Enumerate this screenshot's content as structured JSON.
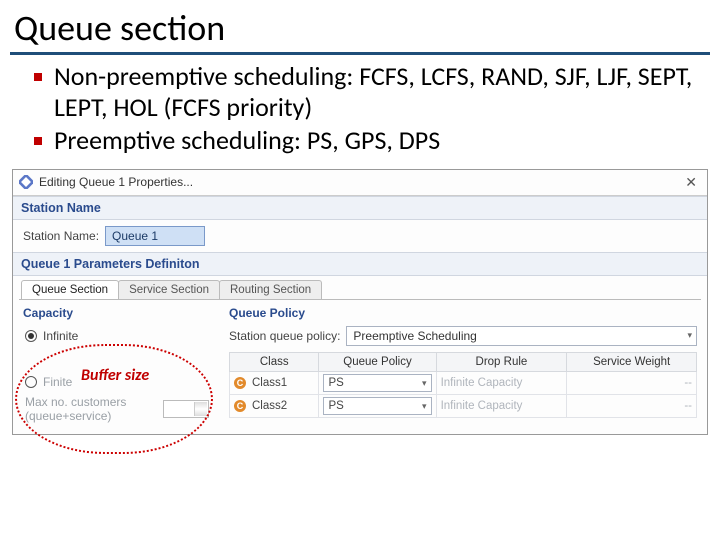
{
  "slide": {
    "title": "Queue section",
    "bullets": [
      "Non-preemptive scheduling: FCFS, LCFS, RAND, SJF, LJF, SEPT, LEPT, HOL (FCFS priority)",
      "Preemptive scheduling: PS, GPS, DPS"
    ]
  },
  "dialog": {
    "title": "Editing Queue 1 Properties...",
    "section_station": "Station Name",
    "station_label": "Station Name:",
    "station_value": "Queue 1",
    "section_params": "Queue 1 Parameters Definiton",
    "tabs": {
      "t0": "Queue Section",
      "t1": "Service Section",
      "t2": "Routing Section",
      "active": 0
    },
    "capacity": {
      "title": "Capacity",
      "opt_infinite": "Infinite",
      "opt_finite": "Finite",
      "max_label": "Max no. customers (queue+service)",
      "max_value": "∞"
    },
    "policy": {
      "title": "Queue Policy",
      "label": "Station queue policy:",
      "value": "Preemptive Scheduling",
      "cols": {
        "c0": "Class",
        "c1": "Queue Policy",
        "c2": "Drop Rule",
        "c3": "Service Weight"
      },
      "rows": [
        {
          "class": "Class1",
          "qp": "PS",
          "drop": "Infinite Capacity",
          "sw": "--"
        },
        {
          "class": "Class2",
          "qp": "PS",
          "drop": "Infinite Capacity",
          "sw": "--"
        }
      ]
    }
  },
  "annotation": {
    "buffer": "Buffer size"
  }
}
